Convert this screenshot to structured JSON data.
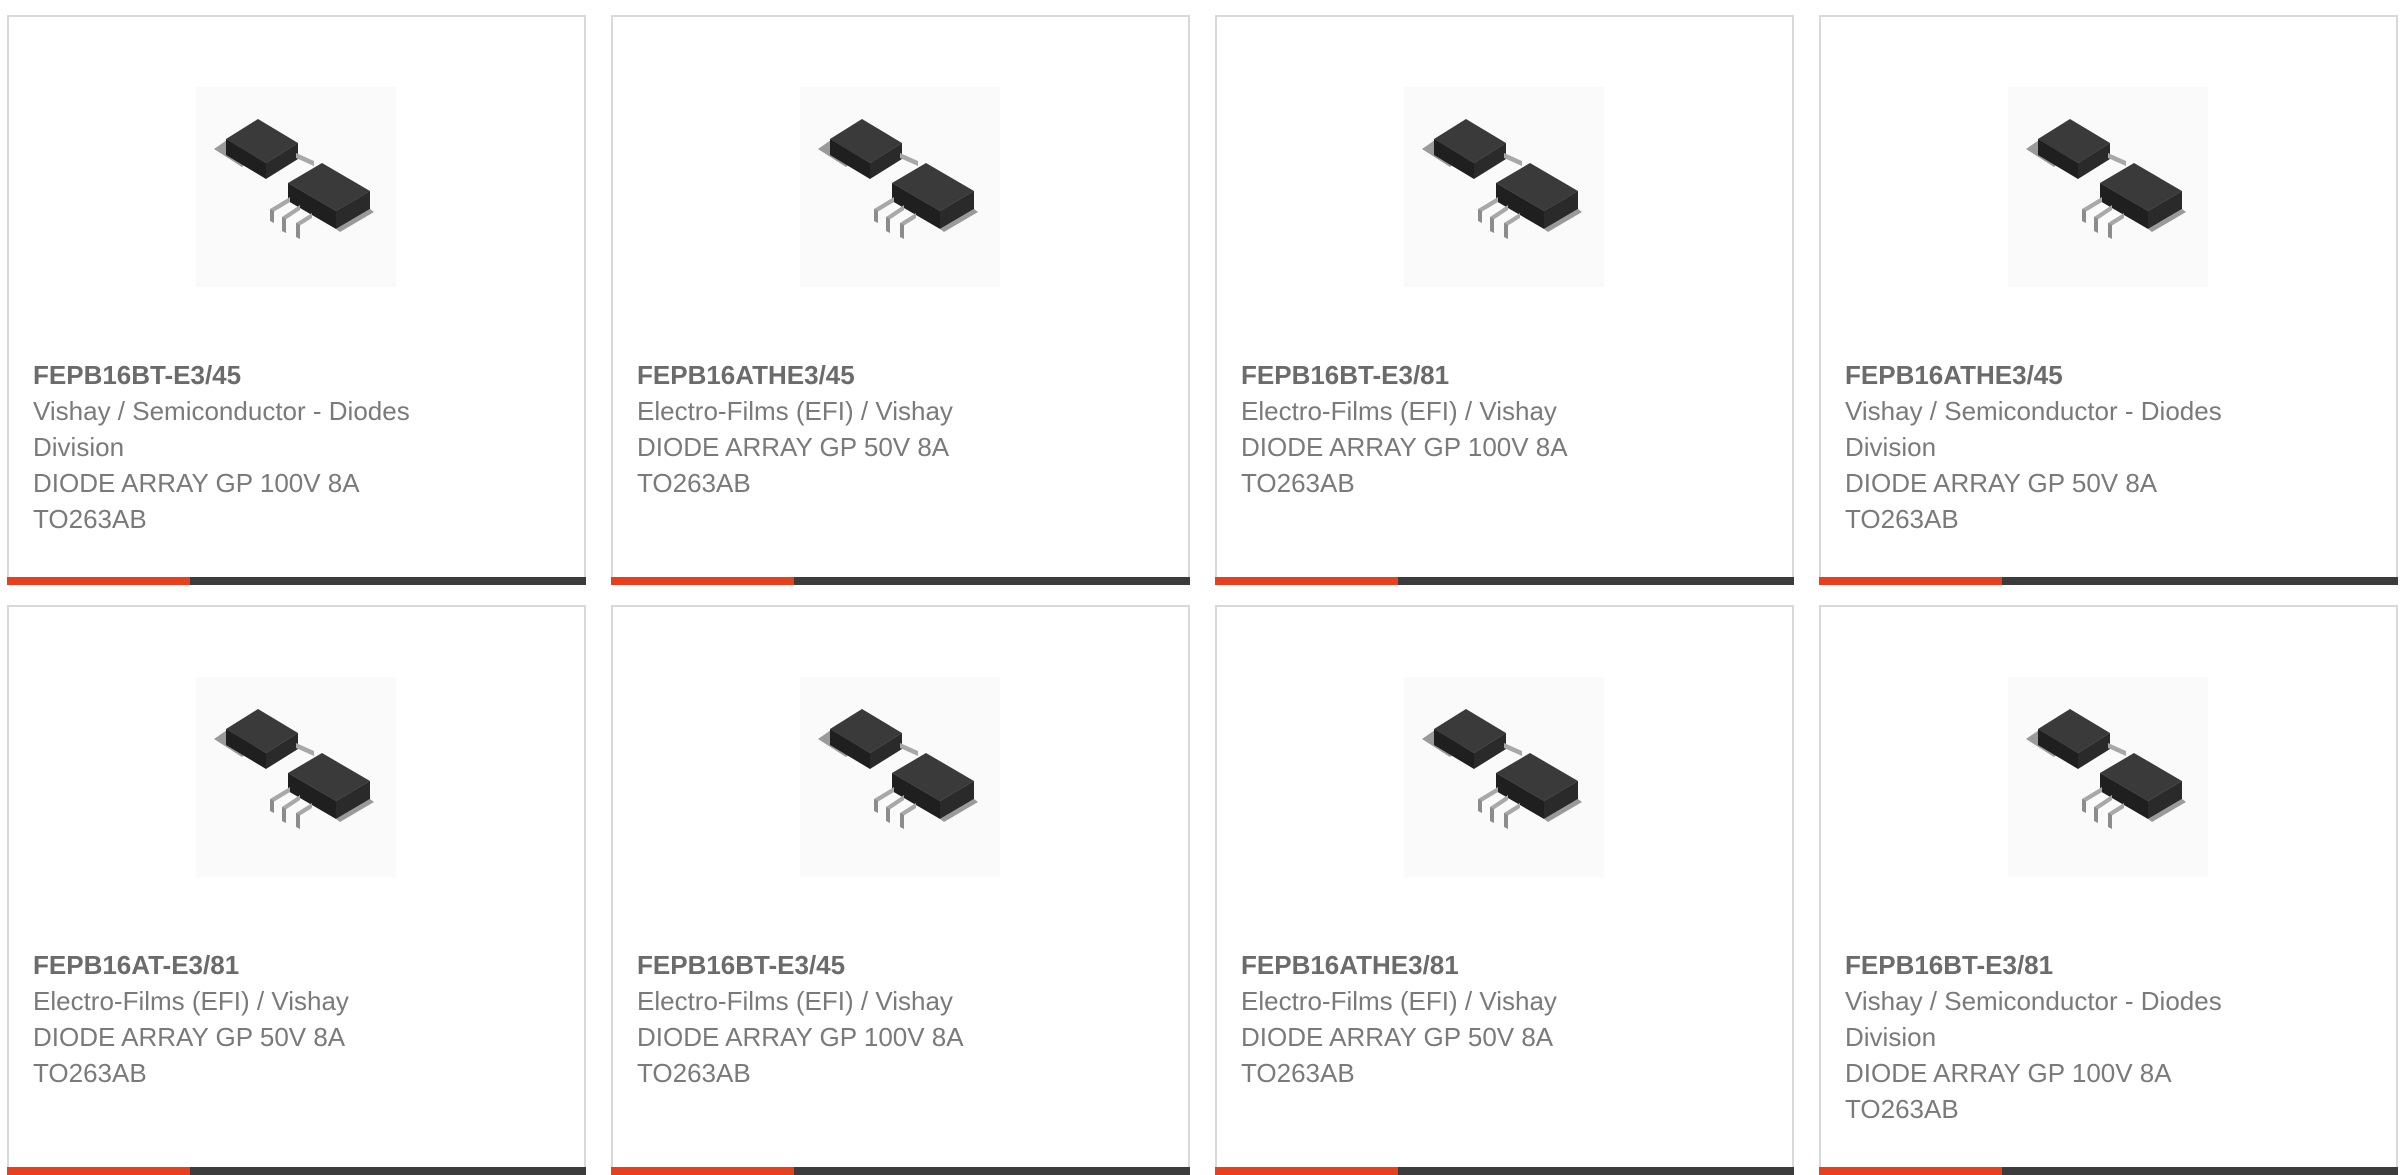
{
  "accent_color": "#e8401c",
  "bar_color": "#3c3c3c",
  "products": [
    {
      "part_number": "FEPB16BT-E3/45",
      "manufacturer": "Vishay / Semiconductor - Diodes Division",
      "description": "DIODE ARRAY GP 100V 8A TO263AB",
      "image": "to263ab-package-image"
    },
    {
      "part_number": "FEPB16ATHE3/45",
      "manufacturer": "Electro-Films (EFI) / Vishay",
      "description": "DIODE ARRAY GP 50V 8A TO263AB",
      "image": "to263ab-package-image"
    },
    {
      "part_number": "FEPB16BT-E3/81",
      "manufacturer": "Electro-Films (EFI) / Vishay",
      "description": "DIODE ARRAY GP 100V 8A TO263AB",
      "image": "to263ab-package-image"
    },
    {
      "part_number": "FEPB16ATHE3/45",
      "manufacturer": "Vishay / Semiconductor - Diodes Division",
      "description": "DIODE ARRAY GP 50V 8A TO263AB",
      "image": "to263ab-package-image"
    },
    {
      "part_number": "FEPB16AT-E3/81",
      "manufacturer": "Electro-Films (EFI) / Vishay",
      "description": "DIODE ARRAY GP 50V 8A TO263AB",
      "image": "to263ab-package-image"
    },
    {
      "part_number": "FEPB16BT-E3/45",
      "manufacturer": "Electro-Films (EFI) / Vishay",
      "description": "DIODE ARRAY GP 100V 8A TO263AB",
      "image": "to263ab-package-image"
    },
    {
      "part_number": "FEPB16ATHE3/81",
      "manufacturer": "Electro-Films (EFI) / Vishay",
      "description": "DIODE ARRAY GP 50V 8A TO263AB",
      "image": "to263ab-package-image"
    },
    {
      "part_number": "FEPB16BT-E3/81",
      "manufacturer": "Vishay / Semiconductor - Diodes Division",
      "description": "DIODE ARRAY GP 100V 8A TO263AB",
      "image": "to263ab-package-image"
    }
  ]
}
